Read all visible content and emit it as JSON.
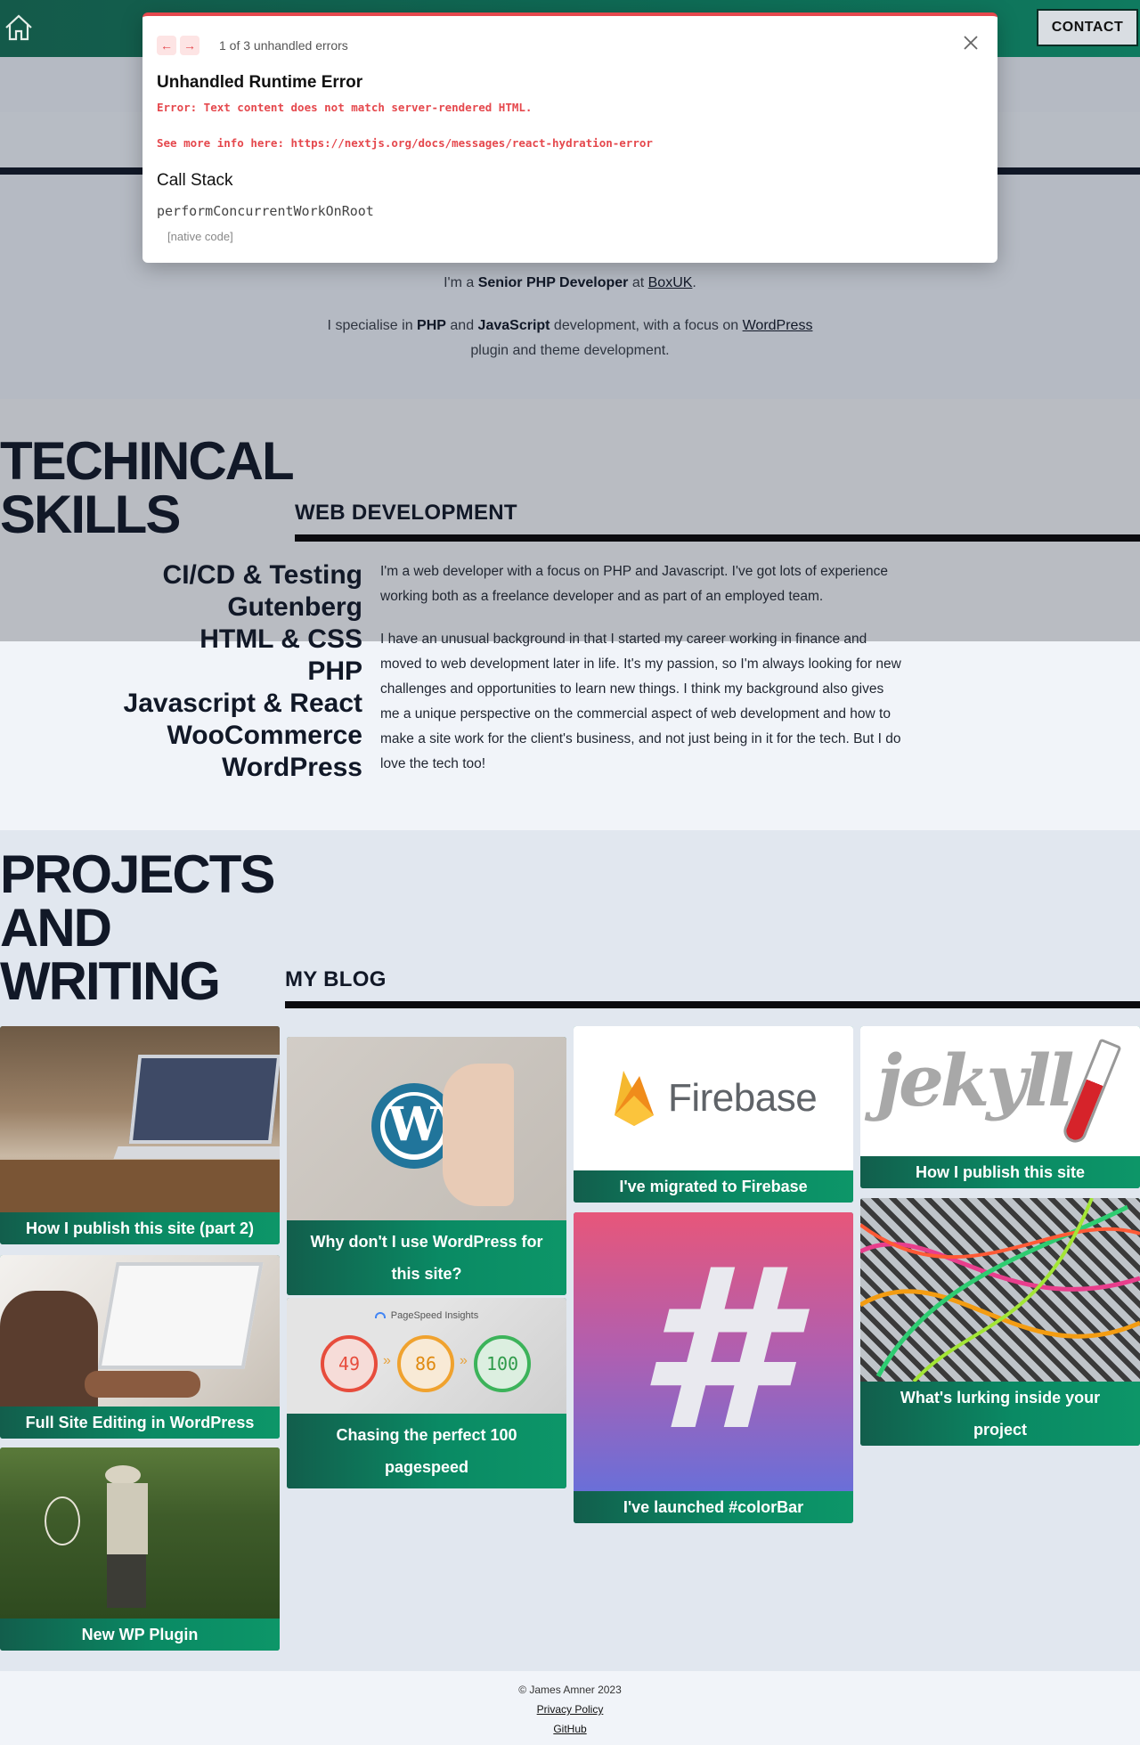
{
  "header": {
    "contact_label": "CONTACT"
  },
  "hero": {
    "line1_prefix": "I'm a ",
    "line1_role": "Senior PHP Developer",
    "line1_mid": " at ",
    "line1_company": "BoxUK",
    "line1_suffix": ".",
    "line2_prefix": "I specialise in ",
    "line2_php": "PHP",
    "line2_and": " and ",
    "line2_js": "JavaScript",
    "line2_mid": " development, with a focus on ",
    "line2_wp": "WordPress",
    "line3": "plugin and theme development."
  },
  "skills": {
    "heading_line1": "TECHINCAL",
    "heading_line2": "SKILLS",
    "subheading": "WEB DEVELOPMENT",
    "items": [
      "CI/CD & Testing",
      "Gutenberg",
      "HTML & CSS",
      "PHP",
      "Javascript & React",
      "WooCommerce",
      "WordPress"
    ],
    "para1": "I'm a web developer with a focus on PHP and Javascript. I've got lots of experience working both as a freelance developer and as part of an employed team.",
    "para2": "I have an unusual background in that I started my career working in finance and moved to web development later in life. It's my passion, so I'm always looking for new challenges and opportunities to learn new things. I think my background also gives me a unique perspective on the commercial aspect of web development and how to make a site work for the client's business, and not just being in it for the tech. But I do love the tech too!"
  },
  "projects": {
    "heading_line1": "PROJECTS",
    "heading_line2": "AND",
    "heading_line3": "WRITING",
    "subheading": "MY BLOG",
    "cards": [
      {
        "title": "How I publish this site (part 2)"
      },
      {
        "title": "Full Site Editing in WordPress"
      },
      {
        "title": "New WP Plugin"
      },
      {
        "title": "Why don't I use WordPress for this site?"
      },
      {
        "title": "Chasing the perfect 100 pagespeed",
        "pagespeed_label": "PageSpeed Insights",
        "scores": [
          "49",
          "86",
          "100"
        ]
      },
      {
        "title": "I've migrated to Firebase",
        "logo_text": "Firebase"
      },
      {
        "title": "I've launched #colorBar",
        "glyph": "#"
      },
      {
        "title": "How I publish this site",
        "logo_text": "jekyll"
      },
      {
        "title": "What's lurking inside your project"
      }
    ]
  },
  "footer": {
    "copyright": "© James Amner 2023",
    "privacy": "Privacy Policy",
    "github": "GitHub"
  },
  "error_overlay": {
    "count": "1 of 3 unhandled errors",
    "title": "Unhandled Runtime Error",
    "message": "Error: Text content does not match server-rendered HTML.",
    "more_info": "See more info here: https://nextjs.org/docs/messages/react-hydration-error",
    "callstack_label": "Call Stack",
    "stack_fn": "performConcurrentWorkOnRoot",
    "native": "[native code]"
  },
  "colors": {
    "accent_green": "#0f7b60",
    "error_red": "#e5484d",
    "ink": "#111827"
  }
}
